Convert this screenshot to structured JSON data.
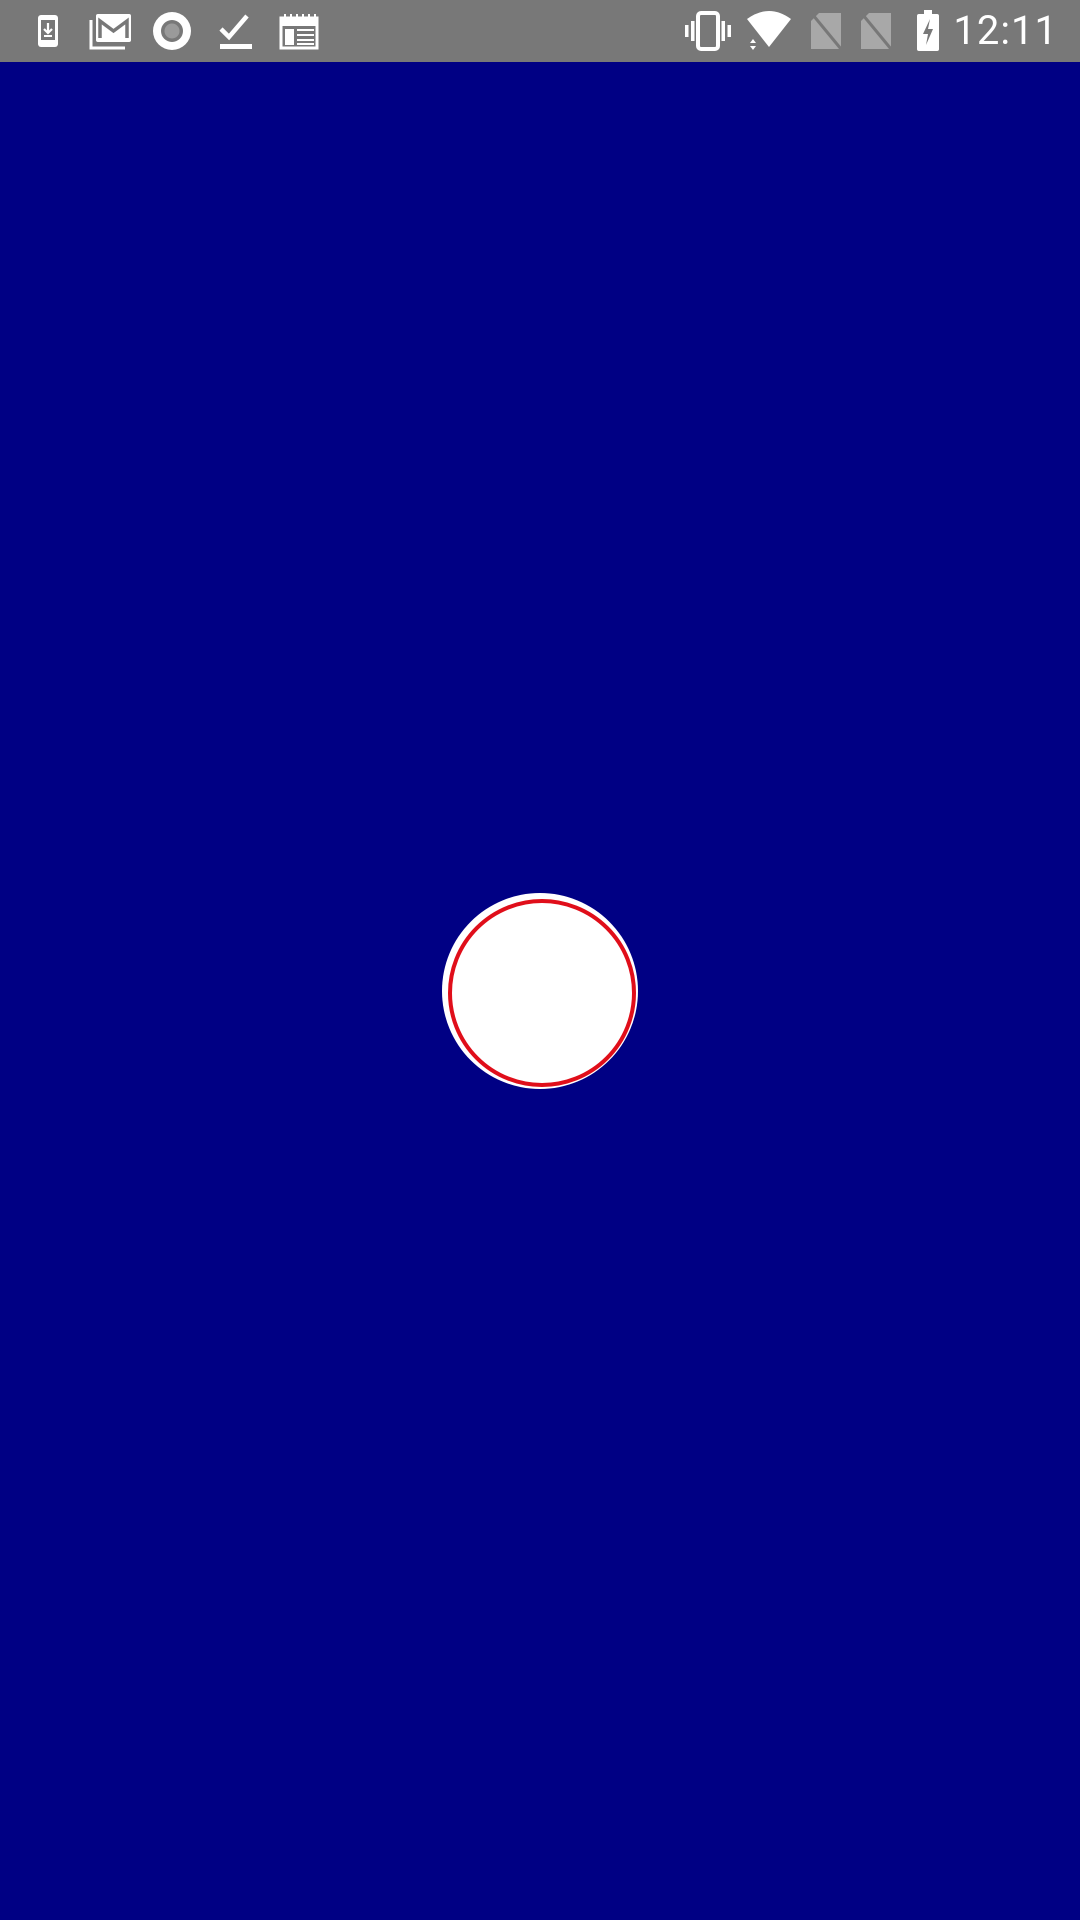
{
  "status_bar": {
    "time": "12:11",
    "background_color": "#787878",
    "left_icons": [
      "download-icon",
      "gmail-icon",
      "record-icon",
      "checkmark-icon",
      "calendar-icon"
    ],
    "right_icons": [
      "vibrate-icon",
      "wifi-icon",
      "sim-no-signal-icon",
      "sim-no-signal-icon",
      "battery-charging-icon"
    ]
  },
  "main": {
    "background_color": "#000084",
    "button": {
      "fill_color": "#ffffff",
      "ring_color": "#e00e1a"
    }
  }
}
